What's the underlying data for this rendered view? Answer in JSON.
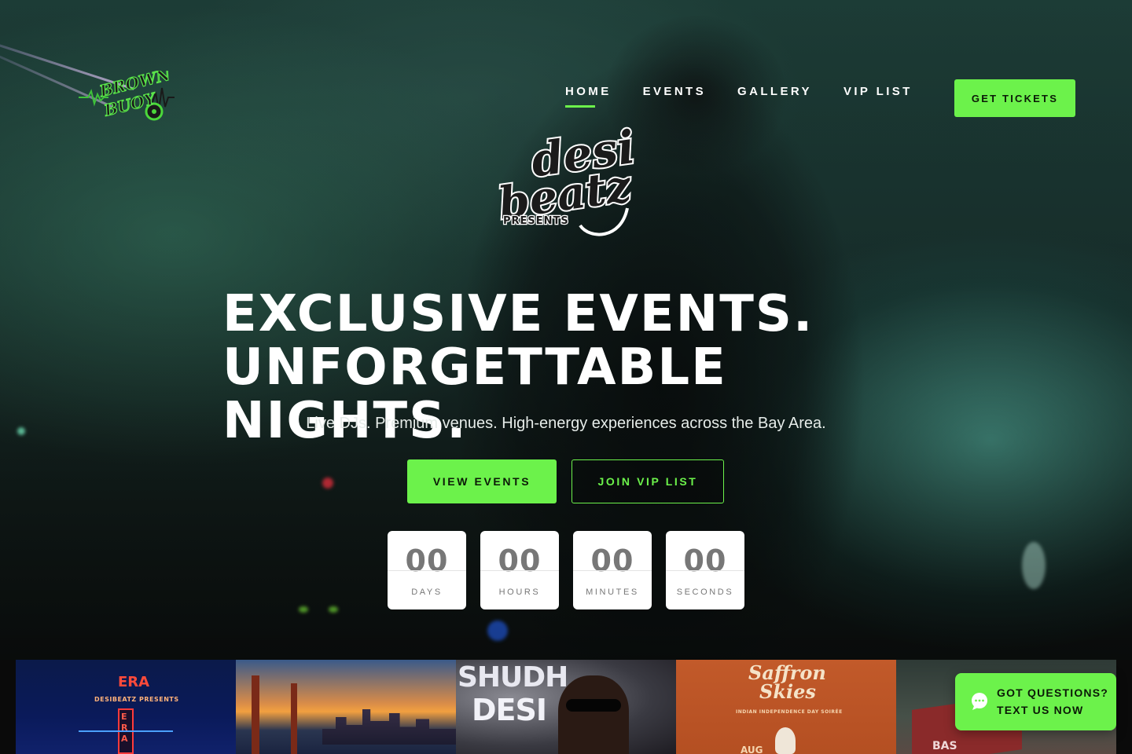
{
  "colors": {
    "accent": "#6cf24b",
    "countdown_text": "#777777"
  },
  "header": {
    "logo_text": [
      "BROWN",
      "BUOY"
    ],
    "nav": [
      {
        "label": "HOME",
        "active": true
      },
      {
        "label": "EVENTS",
        "active": false
      },
      {
        "label": "GALLERY",
        "active": false
      },
      {
        "label": "VIP LIST",
        "active": false
      }
    ],
    "cta_label": "GET TICKETS"
  },
  "center_logo": {
    "line1": "desi",
    "line2": "beatz",
    "line3": "PRESENTS"
  },
  "hero": {
    "headline_line1": "EXCLUSIVE EVENTS.",
    "headline_line2": "UNFORGETTABLE NIGHTS.",
    "subhead": "Live DJs. Premium venues. High-energy experiences across the Bay Area.",
    "primary_button": "VIEW EVENTS",
    "secondary_button": "JOIN VIP LIST"
  },
  "countdown": [
    {
      "value": "00",
      "label": "DAYS"
    },
    {
      "value": "00",
      "label": "HOURS"
    },
    {
      "value": "00",
      "label": "MINUTES"
    },
    {
      "value": "00",
      "label": "SECONDS"
    }
  ],
  "gallery_strip": {
    "tile1": {
      "title": "ERA",
      "subtitle": "DESIBEATZ PRESENTS",
      "sign": "ERA"
    },
    "tile3": {
      "title_line1": "SHUDH",
      "title_line2": "DESI"
    },
    "tile4": {
      "title_line1": "Saffron",
      "title_line2": "Skies",
      "tagline": "INDIAN INDEPENDENCE DAY SOIRÉE",
      "footer": "AUG"
    },
    "tile5": {
      "banner": "BAS"
    }
  },
  "chat_widget": {
    "line1": "GOT QUESTIONS?",
    "line2": "TEXT US NOW",
    "icon": "chat-bubble-icon"
  }
}
